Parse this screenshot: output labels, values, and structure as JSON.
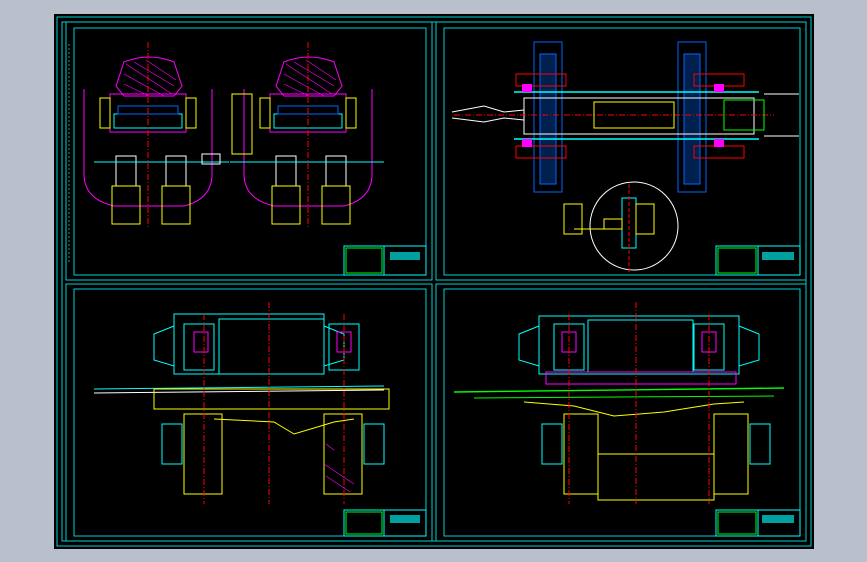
{
  "colors": {
    "background": "#b9c0cc",
    "sheet": "#000000",
    "frame": "#00ffff",
    "magenta": "#ff00ff",
    "yellow": "#ffff00",
    "green": "#00ff00",
    "red": "#ff0000",
    "white": "#ffffff",
    "blue": "#0066ff"
  },
  "drawings": [
    {
      "id": "top-left",
      "view": "end-section-views"
    },
    {
      "id": "top-right",
      "view": "plan-view-with-detail-circle"
    },
    {
      "id": "bottom-left",
      "view": "side-elevation"
    },
    {
      "id": "bottom-right",
      "view": "side-elevation-variant"
    }
  ],
  "title_block_text": ""
}
